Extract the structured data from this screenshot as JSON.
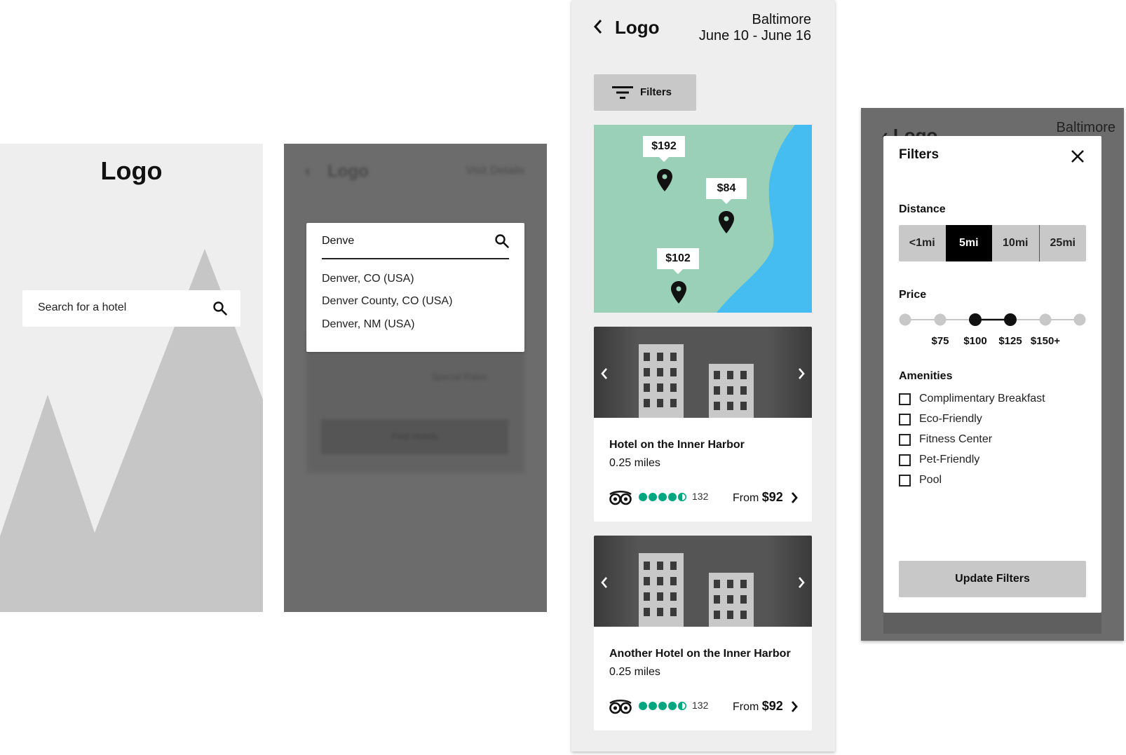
{
  "screen1": {
    "logo": "Logo",
    "search_placeholder": "Search for a hotel"
  },
  "screen2": {
    "bg_logo": "Logo",
    "bg_header_right": "Visit Details",
    "bg_special_rates": "Special Rates",
    "bg_find_button": "Find Hotels",
    "query": "Denve",
    "suggestions": [
      "Denver, CO (USA)",
      "Denver County, CO (USA)",
      "Denver, NM (USA)"
    ]
  },
  "screen3": {
    "logo": "Logo",
    "city": "Baltimore",
    "dates": "June 10 - June 16",
    "filters_label": "Filters",
    "map_prices": [
      "$192",
      "$84",
      "$102"
    ],
    "colors": {
      "land": "#9bd0b8",
      "water": "#45bdf0",
      "rating": "#00a680"
    },
    "hotels": [
      {
        "name": "Hotel on the Inner Harbor",
        "distance": "0.25 miles",
        "rating": 4.5,
        "reviews": "132",
        "from_label": "From",
        "price": "$92"
      },
      {
        "name": "Another Hotel on the Inner Harbor",
        "distance": "0.25 miles",
        "rating": 4.5,
        "reviews": "132",
        "from_label": "From",
        "price": "$92"
      }
    ]
  },
  "screen4": {
    "bg_logo": "Logo",
    "bg_city": "Baltimore",
    "title": "Filters",
    "distance_label": "Distance",
    "distance_options": [
      "<1mi",
      "5mi",
      "10mi",
      "25mi"
    ],
    "distance_selected": "5mi",
    "price_label": "Price",
    "price_labels": [
      "$75",
      "$100",
      "$125",
      "$150+"
    ],
    "price_range_selected": [
      "$100",
      "$125"
    ],
    "amenities_label": "Amenities",
    "amenities": [
      "Complimentary Breakfast",
      "Eco-Friendly",
      "Fitness Center",
      "Pet-Friendly",
      "Pool"
    ],
    "update_label": "Update Filters"
  }
}
